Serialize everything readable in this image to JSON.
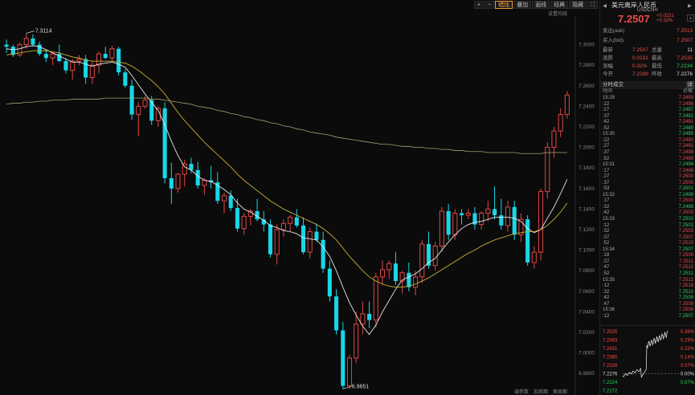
{
  "toolbar": {
    "plus": "+",
    "minus": "−",
    "overlay": "叠加",
    "draw": "画线",
    "classic": "经典",
    "hide": "隐藏",
    "candle": "蜡烛",
    "expand": "⛶"
  },
  "settings_label": "设置均线",
  "bottom_bar": [
    "调参数",
    "加周期",
    "换周期"
  ],
  "panel": {
    "title": "美元离岸人民币",
    "symbol": "USDCNH",
    "price": "7.2507",
    "change": "+0.0231",
    "change_pct": "+0.32%",
    "ask_label": "卖出(ask)",
    "ask": "7.2513",
    "bid_label": "买入(bid)",
    "bid": "7.2507",
    "stats": [
      {
        "l1": "最新",
        "v1": "7.2507",
        "c1": "red",
        "l2": "总量",
        "v2": "11",
        "c2": "white"
      },
      {
        "l1": "涨跌",
        "v1": "0.0231",
        "c1": "red",
        "l2": "最高",
        "v2": "7.2535",
        "c2": "red"
      },
      {
        "l1": "涨幅",
        "v1": "0.32%",
        "c1": "red",
        "l2": "最低",
        "v2": "7.2234",
        "c2": "green"
      },
      {
        "l1": "今开",
        "v1": "7.2288",
        "c1": "red",
        "l2": "昨收",
        "v2": "7.2276",
        "c2": "white"
      }
    ],
    "trades_title": "分时成交",
    "trades_col_time": "时间",
    "trades_col_price": "价格",
    "trades": [
      {
        "t": "15:29",
        "p": "7.2493"
      },
      {
        "t": ":22",
        "p": "7.2498"
      },
      {
        "t": ":27",
        "p": "7.2497"
      },
      {
        "t": ":37",
        "p": "7.2491"
      },
      {
        "t": ":42",
        "p": "7.2491"
      },
      {
        "t": ":52",
        "p": "7.2489"
      },
      {
        "t": "15:30",
        "p": "7.2485"
      },
      {
        "t": ":22",
        "p": "7.2490"
      },
      {
        "t": ":27",
        "p": "7.2491"
      },
      {
        "t": ":37",
        "p": "7.2499"
      },
      {
        "t": ":52",
        "p": "7.2499"
      },
      {
        "t": "15:31",
        "p": "7.2494"
      },
      {
        "t": ":17",
        "p": "7.2496"
      },
      {
        "t": ":27",
        "p": "7.2500"
      },
      {
        "t": ":37",
        "p": "7.2505"
      },
      {
        "t": ":53",
        "p": "7.2501"
      },
      {
        "t": "15:32",
        "p": "7.2498"
      },
      {
        "t": ":17",
        "p": "7.2500"
      },
      {
        "t": ":32",
        "p": "7.2498"
      },
      {
        "t": ":42",
        "p": "7.2503"
      },
      {
        "t": "15:33",
        "p": "7.2502"
      },
      {
        "t": ":12",
        "p": "7.2501"
      },
      {
        "t": ":32",
        "p": "7.2503"
      },
      {
        "t": ":37",
        "p": "7.2507"
      },
      {
        "t": ":52",
        "p": "7.2510"
      },
      {
        "t": "15:34",
        "p": "7.2507"
      },
      {
        "t": ":18",
        "p": "7.2508"
      },
      {
        "t": ":37",
        "p": "7.2511"
      },
      {
        "t": ":47",
        "p": "7.2512"
      },
      {
        "t": ":52",
        "p": "7.2511"
      },
      {
        "t": "15:35",
        "p": "7.2512"
      },
      {
        "t": ":12",
        "p": "7.2516"
      },
      {
        "t": ":32",
        "p": "7.2510"
      },
      {
        "t": ":42",
        "p": "7.2509"
      },
      {
        "t": ":47",
        "p": "7.2509"
      },
      {
        "t": "15:36",
        "p": "7.2509"
      },
      {
        "t": ":12",
        "p": "7.2507"
      }
    ],
    "mini_prices": [
      "7.2535",
      "7.2483",
      "7.2431",
      "7.2380",
      "7.2328",
      "7.2276",
      "7.2224",
      "7.2172"
    ],
    "mini_pcts": [
      "0.36%",
      "0.29%",
      "0.22%",
      "0.14%",
      "0.07%",
      "0.00%",
      "0.07%"
    ]
  },
  "chart_data": {
    "type": "candlestick",
    "ylim": [
      6.97,
      7.32
    ],
    "y_ticks": [
      "7.3000",
      "7.2800",
      "7.2600",
      "7.2400",
      "7.2200",
      "7.2000",
      "7.1800",
      "7.1600",
      "7.1400",
      "7.1200",
      "7.1000",
      "7.0800",
      "7.0600",
      "7.0400",
      "7.0200",
      "7.0000",
      "6.9800"
    ],
    "annotations": [
      {
        "label": "7.3114"
      },
      {
        "label": "6.9651"
      }
    ],
    "candles": [
      [
        7.3,
        7.305,
        7.292,
        7.298
      ],
      [
        7.298,
        7.3,
        7.288,
        7.29
      ],
      [
        7.29,
        7.302,
        7.288,
        7.3
      ],
      [
        7.3,
        7.311,
        7.296,
        7.306
      ],
      [
        7.306,
        7.31,
        7.298,
        7.3
      ],
      [
        7.3,
        7.303,
        7.289,
        7.291
      ],
      [
        7.291,
        7.295,
        7.283,
        7.287
      ],
      [
        7.287,
        7.293,
        7.28,
        7.291
      ],
      [
        7.291,
        7.3,
        7.283,
        7.284
      ],
      [
        7.284,
        7.287,
        7.272,
        7.275
      ],
      [
        7.275,
        7.286,
        7.266,
        7.284
      ],
      [
        7.284,
        7.29,
        7.28,
        7.286
      ],
      [
        7.286,
        7.29,
        7.262,
        7.268
      ],
      [
        7.268,
        7.284,
        7.262,
        7.28
      ],
      [
        7.28,
        7.293,
        7.272,
        7.291
      ],
      [
        7.291,
        7.298,
        7.286,
        7.287
      ],
      [
        7.287,
        7.299,
        7.284,
        7.296
      ],
      [
        7.296,
        7.298,
        7.27,
        7.273
      ],
      [
        7.273,
        7.276,
        7.258,
        7.26
      ],
      [
        7.26,
        7.266,
        7.227,
        7.232
      ],
      [
        7.232,
        7.244,
        7.211,
        7.24
      ],
      [
        7.24,
        7.25,
        7.238,
        7.246
      ],
      [
        7.246,
        7.25,
        7.222,
        7.226
      ],
      [
        7.226,
        7.24,
        7.22,
        7.238
      ],
      [
        7.238,
        7.244,
        7.165,
        7.17
      ],
      [
        7.17,
        7.185,
        7.145,
        7.16
      ],
      [
        7.16,
        7.175,
        7.156,
        7.174
      ],
      [
        7.174,
        7.188,
        7.162,
        7.184
      ],
      [
        7.184,
        7.19,
        7.175,
        7.178
      ],
      [
        7.178,
        7.186,
        7.16,
        7.163
      ],
      [
        7.163,
        7.17,
        7.154,
        7.168
      ],
      [
        7.168,
        7.182,
        7.16,
        7.166
      ],
      [
        7.166,
        7.176,
        7.145,
        7.148
      ],
      [
        7.148,
        7.156,
        7.136,
        7.153
      ],
      [
        7.153,
        7.158,
        7.138,
        7.141
      ],
      [
        7.141,
        7.15,
        7.118,
        7.121
      ],
      [
        7.121,
        7.136,
        7.115,
        7.133
      ],
      [
        7.133,
        7.14,
        7.124,
        7.138
      ],
      [
        7.138,
        7.15,
        7.128,
        7.13
      ],
      [
        7.13,
        7.138,
        7.118,
        7.125
      ],
      [
        7.125,
        7.13,
        7.093,
        7.096
      ],
      [
        7.096,
        7.125,
        7.086,
        7.12
      ],
      [
        7.12,
        7.13,
        7.113,
        7.126
      ],
      [
        7.126,
        7.134,
        7.118,
        7.132
      ],
      [
        7.132,
        7.14,
        7.122,
        7.124
      ],
      [
        7.124,
        7.132,
        7.096,
        7.098
      ],
      [
        7.098,
        7.122,
        7.092,
        7.118
      ],
      [
        7.118,
        7.126,
        7.108,
        7.11
      ],
      [
        7.11,
        7.118,
        7.078,
        7.082
      ],
      [
        7.082,
        7.09,
        7.05,
        7.055
      ],
      [
        7.055,
        7.062,
        7.018,
        7.022
      ],
      [
        7.022,
        7.03,
        6.965,
        6.968
      ],
      [
        6.968,
        6.998,
        6.965,
        6.995
      ],
      [
        6.995,
        7.04,
        6.99,
        7.028
      ],
      [
        7.028,
        7.05,
        7.018,
        7.038
      ],
      [
        7.038,
        7.05,
        7.024,
        7.032
      ],
      [
        7.032,
        7.078,
        7.025,
        7.074
      ],
      [
        7.074,
        7.09,
        7.066,
        7.081
      ],
      [
        7.081,
        7.09,
        7.072,
        7.087
      ],
      [
        7.087,
        7.098,
        7.066,
        7.07
      ],
      [
        7.07,
        7.08,
        7.058,
        7.078
      ],
      [
        7.078,
        7.088,
        7.06,
        7.064
      ],
      [
        7.064,
        7.08,
        7.056,
        7.074
      ],
      [
        7.074,
        7.11,
        7.068,
        7.106
      ],
      [
        7.106,
        7.118,
        7.082,
        7.085
      ],
      [
        7.085,
        7.108,
        7.08,
        7.104
      ],
      [
        7.104,
        7.142,
        7.098,
        7.138
      ],
      [
        7.138,
        7.145,
        7.11,
        7.115
      ],
      [
        7.115,
        7.14,
        7.11,
        7.136
      ],
      [
        7.136,
        7.14,
        7.125,
        7.134
      ],
      [
        7.134,
        7.14,
        7.13,
        7.136
      ],
      [
        7.136,
        7.142,
        7.12,
        7.125
      ],
      [
        7.125,
        7.138,
        7.12,
        7.136
      ],
      [
        7.136,
        7.148,
        7.128,
        7.14
      ],
      [
        7.14,
        7.162,
        7.13,
        7.134
      ],
      [
        7.134,
        7.15,
        7.12,
        7.124
      ],
      [
        7.124,
        7.148,
        7.118,
        7.142
      ],
      [
        7.142,
        7.148,
        7.11,
        7.115
      ],
      [
        7.115,
        7.136,
        7.108,
        7.13
      ],
      [
        7.13,
        7.134,
        7.085,
        7.088
      ],
      [
        7.088,
        7.104,
        7.082,
        7.098
      ],
      [
        7.098,
        7.16,
        7.09,
        7.157
      ],
      [
        7.157,
        7.205,
        7.15,
        7.2
      ],
      [
        7.2,
        7.22,
        7.19,
        7.216
      ],
      [
        7.216,
        7.238,
        7.21,
        7.232
      ],
      [
        7.232,
        7.255,
        7.228,
        7.251
      ]
    ],
    "series": [
      {
        "type": "line",
        "values": [
          7.296,
          7.295,
          7.296,
          7.298,
          7.299,
          7.298,
          7.295,
          7.292,
          7.289,
          7.286,
          7.283,
          7.283,
          7.281,
          7.279,
          7.281,
          7.282,
          7.283,
          7.281,
          7.278,
          7.27,
          7.261,
          7.252,
          7.244,
          7.236,
          7.222,
          7.206,
          7.192,
          7.181,
          7.178,
          7.172,
          7.168,
          7.167,
          7.163,
          7.159,
          7.154,
          7.146,
          7.14,
          7.137,
          7.133,
          7.129,
          7.124,
          7.122,
          7.119,
          7.118,
          7.116,
          7.112,
          7.111,
          7.11,
          7.103,
          7.094,
          7.08,
          7.064,
          7.049,
          7.037,
          7.026,
          7.018,
          7.027,
          7.04,
          7.051,
          7.062,
          7.071,
          7.074,
          7.077,
          7.082,
          7.088,
          7.092,
          7.1,
          7.108,
          7.115,
          7.121,
          7.125,
          7.127,
          7.128,
          7.13,
          7.132,
          7.132,
          7.132,
          7.131,
          7.128,
          7.121,
          7.117,
          7.12,
          7.131,
          7.142,
          7.155,
          7.169
        ]
      },
      {
        "type": "line",
        "values": [
          7.29,
          7.291,
          7.292,
          7.293,
          7.294,
          7.294,
          7.294,
          7.293,
          7.292,
          7.29,
          7.288,
          7.287,
          7.285,
          7.284,
          7.284,
          7.284,
          7.284,
          7.283,
          7.282,
          7.279,
          7.275,
          7.27,
          7.265,
          7.259,
          7.252,
          7.243,
          7.234,
          7.226,
          7.219,
          7.212,
          7.205,
          7.199,
          7.193,
          7.187,
          7.181,
          7.174,
          7.168,
          7.163,
          7.158,
          7.153,
          7.148,
          7.144,
          7.14,
          7.137,
          7.134,
          7.131,
          7.128,
          7.125,
          7.121,
          7.116,
          7.11,
          7.102,
          7.094,
          7.087,
          7.08,
          7.074,
          7.07,
          7.067,
          7.065,
          7.064,
          7.064,
          7.065,
          7.067,
          7.07,
          7.073,
          7.077,
          7.081,
          7.085,
          7.089,
          7.093,
          7.097,
          7.1,
          7.104,
          7.107,
          7.11,
          7.112,
          7.114,
          7.116,
          7.117,
          7.118,
          7.118,
          7.12,
          7.124,
          7.13,
          7.137,
          7.146
        ]
      },
      {
        "type": "line",
        "values": [
          7.242,
          7.243,
          7.243,
          7.244,
          7.244,
          7.245,
          7.245,
          7.246,
          7.246,
          7.246,
          7.247,
          7.247,
          7.247,
          7.247,
          7.247,
          7.248,
          7.248,
          7.248,
          7.248,
          7.248,
          7.248,
          7.248,
          7.247,
          7.247,
          7.246,
          7.245,
          7.244,
          7.243,
          7.242,
          7.24,
          7.239,
          7.238,
          7.236,
          7.235,
          7.233,
          7.232,
          7.23,
          7.229,
          7.227,
          7.226,
          7.224,
          7.223,
          7.221,
          7.22,
          7.218,
          7.217,
          7.215,
          7.214,
          7.213,
          7.212,
          7.21,
          7.209,
          7.208,
          7.207,
          7.206,
          7.205,
          7.204,
          7.203,
          7.203,
          7.202,
          7.201,
          7.201,
          7.2,
          7.2,
          7.199,
          7.199,
          7.198,
          7.198,
          7.197,
          7.197,
          7.196,
          7.196,
          7.196,
          7.195,
          7.195,
          7.195,
          7.195,
          7.195,
          7.194,
          7.194,
          7.194,
          7.194,
          7.195,
          7.195,
          7.195,
          7.195
        ]
      }
    ]
  }
}
